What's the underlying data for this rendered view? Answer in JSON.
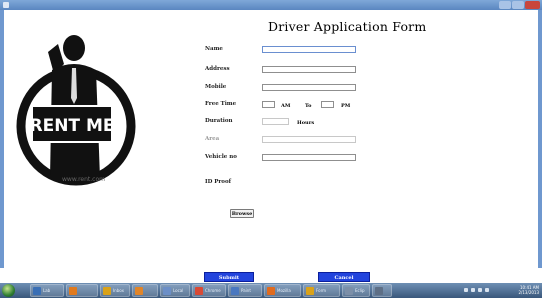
{
  "form": {
    "title": "Driver Application Form",
    "labels": {
      "name": "Name",
      "address": "Address",
      "mobile": "Mobile",
      "free_time": "Free Time",
      "duration": "Duration",
      "area": "Area",
      "vehicle_no": "Vehicle no",
      "id_proof": "ID Proof"
    },
    "fields": {
      "name": "",
      "address": "",
      "mobile": "",
      "free_time_from": "",
      "free_time_to": "",
      "duration": "",
      "area": "",
      "vehicle_no": ""
    },
    "free_time_am": "AM",
    "free_time_to_label": "To",
    "free_time_pm": "PM",
    "duration_unit": "Hours",
    "browse_label": "Browse",
    "submit_label": "Submit",
    "cancel_label": "Cancel"
  },
  "logo": {
    "text": "RENT ME",
    "caption": "www.rent.com"
  },
  "taskbar": {
    "items": [
      {
        "label": "Lab",
        "color": "#3a6fb5"
      },
      {
        "label": "",
        "color": "#e07a1f"
      },
      {
        "label": "Inbox",
        "color": "#d9a21a"
      },
      {
        "label": "",
        "color": "#e0852a"
      },
      {
        "label": "Local",
        "color": "#6c8fc7"
      },
      {
        "label": "Chrome",
        "color": "#d84a36"
      },
      {
        "label": "Paint",
        "color": "#4a78c0"
      },
      {
        "label": "Mozilla",
        "color": "#e06b1f"
      },
      {
        "label": "Form",
        "color": "#d9a21a"
      },
      {
        "label": "Eclip",
        "color": "#7c8fa8"
      },
      {
        "label": "",
        "color": "#5e6f86"
      }
    ],
    "time": "10:41 AM",
    "date": "2/13/2013"
  },
  "colors": {
    "button_blue": "#2244dd",
    "title_bar": "#5a86c0",
    "close_button": "#c9463d"
  }
}
